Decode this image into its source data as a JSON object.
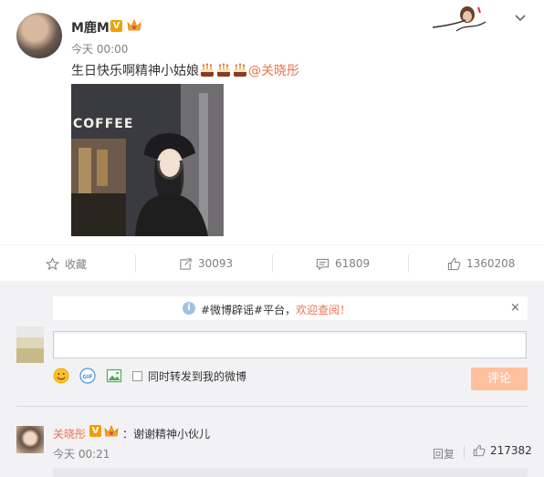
{
  "post": {
    "username": "M鹿M",
    "time": "今天 00:00",
    "text_main": "生日快乐啊精神小姑娘",
    "mention": "@关晓彤",
    "photo_sign": "COFFEE",
    "more_label": "chevron-down-icon"
  },
  "actions": {
    "favorite": "收藏",
    "repost_count": "30093",
    "comment_count": "61809",
    "like_count": "1360208"
  },
  "comment_box": {
    "notice_text": "#微博辟谣#平台，",
    "notice_link": "欢迎查阅！",
    "close_label": "×",
    "input_value": "",
    "also_repost_label": "同时转发到我的微博",
    "submit_label": "评论"
  },
  "comment": {
    "author": "关晓彤",
    "text": "：谢谢精神小伙儿",
    "time": "今天 00:21",
    "reply_label": "回复",
    "like_count": "217382"
  },
  "colors": {
    "accent": "#eb7350",
    "vip_badge": "#f0a000",
    "submit_disabled": "#ffc09f",
    "comment_bg": "#f2f2f5"
  }
}
